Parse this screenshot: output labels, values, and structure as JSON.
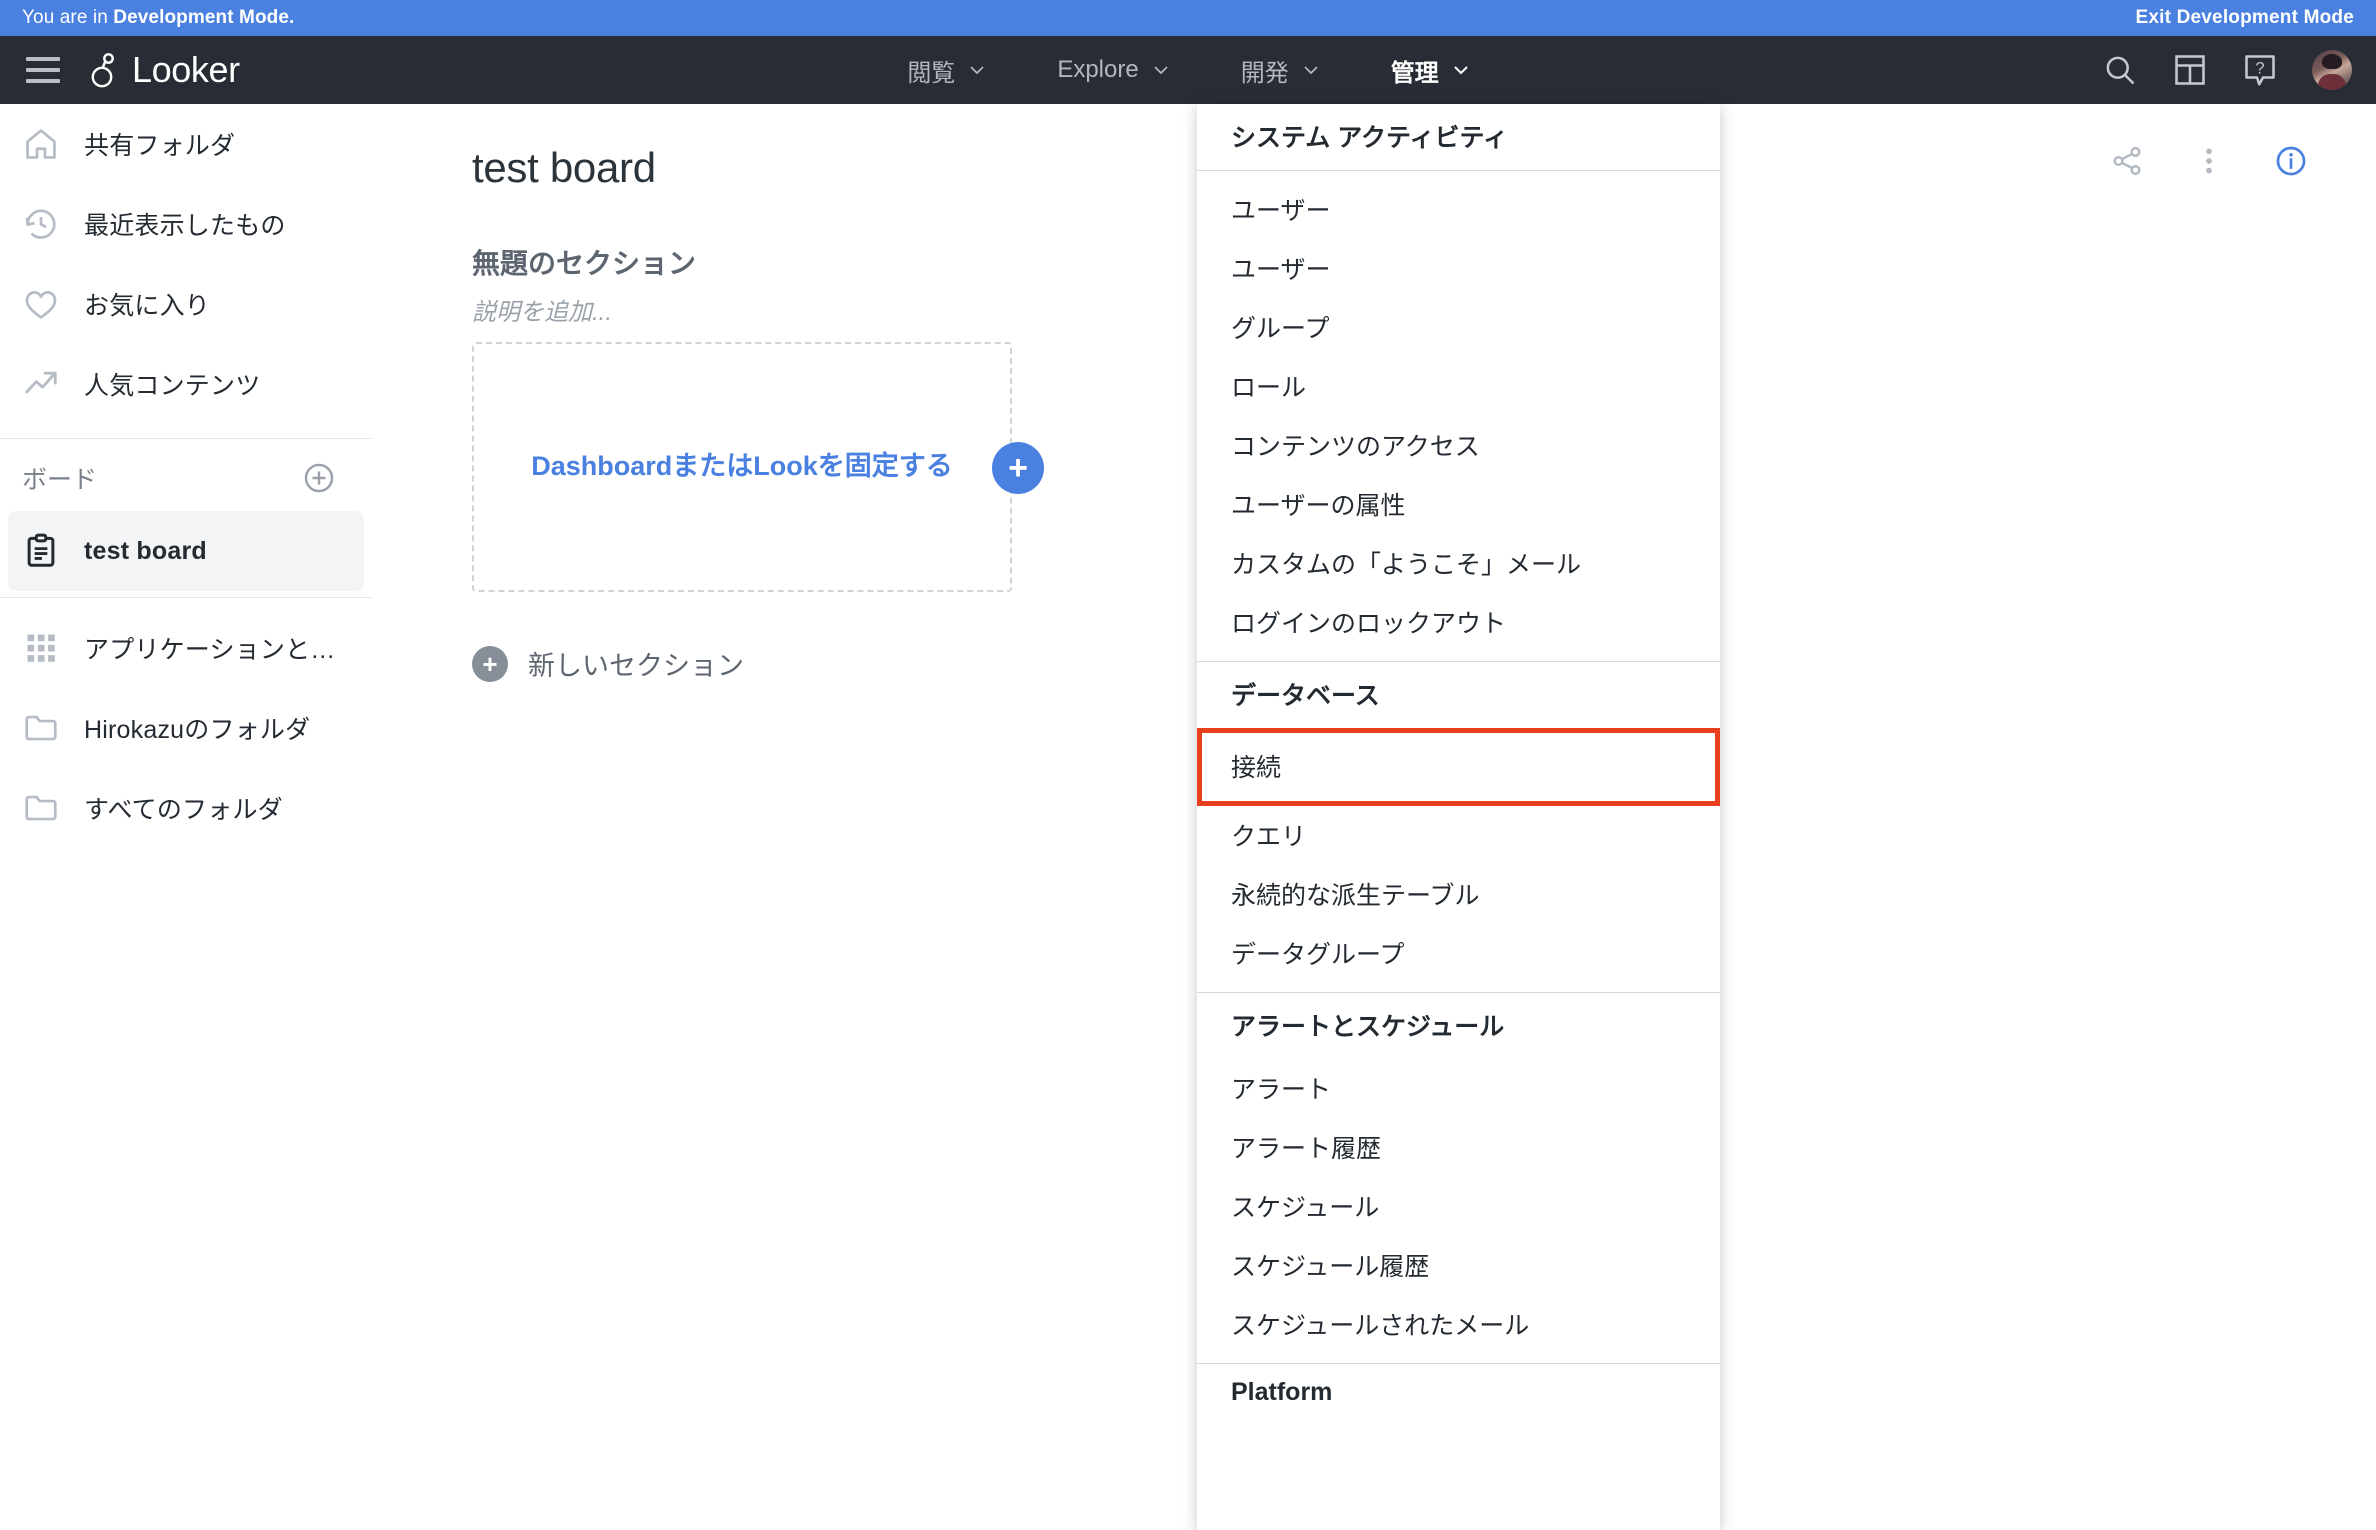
{
  "dev_banner": {
    "message_prefix": "You are in ",
    "message_bold": "Development Mode.",
    "exit_label": "Exit Development Mode",
    "background_color": "#4a80e0"
  },
  "topbar": {
    "hamburger_name": "menu-icon",
    "brand": "Looker",
    "nav": [
      {
        "label": "閲覧",
        "active": false
      },
      {
        "label": "Explore",
        "active": false
      },
      {
        "label": "開発",
        "active": false
      },
      {
        "label": "管理",
        "active": true
      }
    ],
    "icons": [
      "search-icon",
      "marketplace-icon",
      "help-icon",
      "avatar"
    ],
    "background_color": "#282c34"
  },
  "sidebar": {
    "primary_items": [
      {
        "icon": "home-icon",
        "label": "共有フォルダ"
      },
      {
        "icon": "history-icon",
        "label": "最近表示したもの"
      },
      {
        "icon": "heart-icon",
        "label": "お気に入り"
      },
      {
        "icon": "trending-up-icon",
        "label": "人気コンテンツ"
      }
    ],
    "boards_header": {
      "label": "ボード",
      "add_icon": "plus-circle-icon"
    },
    "boards": [
      {
        "icon": "clipboard-icon",
        "label": "test board",
        "selected": true
      }
    ],
    "secondary_items": [
      {
        "icon": "grid-apps-icon",
        "label": "アプリケーションと…"
      },
      {
        "icon": "folder-icon",
        "label": "Hirokazuのフォルダ"
      },
      {
        "icon": "folder-icon",
        "label": "すべてのフォルダ"
      }
    ]
  },
  "main": {
    "board_title": "test board",
    "actions": [
      "share-icon",
      "more-vertical-icon",
      "info-icon"
    ],
    "section_title": "無題のセクション",
    "section_description_placeholder": "説明を追加...",
    "pin_cta": "DashboardまたはLookを固定する",
    "pin_fab_label": "+",
    "new_section_label": "新しいセクション",
    "new_section_icon_label": "+",
    "accent_color": "#4a80e0"
  },
  "admin_menu": {
    "highlight_color": "#e8401f",
    "groups": [
      {
        "header": "システム アクティビティ",
        "items": []
      },
      {
        "header": null,
        "items": [
          {
            "label": "ユーザー",
            "highlighted": false
          },
          {
            "label": "ユーザー",
            "highlighted": false
          },
          {
            "label": "グループ",
            "highlighted": false
          },
          {
            "label": "ロール",
            "highlighted": false
          },
          {
            "label": "コンテンツのアクセス",
            "highlighted": false
          },
          {
            "label": "ユーザーの属性",
            "highlighted": false
          },
          {
            "label": "カスタムの「ようこそ」メール",
            "highlighted": false
          },
          {
            "label": "ログインのロックアウト",
            "highlighted": false
          }
        ]
      },
      {
        "header": "データベース",
        "items": [
          {
            "label": "接続",
            "highlighted": true
          },
          {
            "label": "クエリ",
            "highlighted": false
          },
          {
            "label": "永続的な派生テーブル",
            "highlighted": false
          },
          {
            "label": "データグループ",
            "highlighted": false
          }
        ]
      },
      {
        "header": "アラートとスケジュール",
        "items": [
          {
            "label": "アラート",
            "highlighted": false
          },
          {
            "label": "アラート履歴",
            "highlighted": false
          },
          {
            "label": "スケジュール",
            "highlighted": false
          },
          {
            "label": "スケジュール履歴",
            "highlighted": false
          },
          {
            "label": "スケジュールされたメール",
            "highlighted": false
          }
        ]
      },
      {
        "header": "Platform",
        "items": []
      }
    ]
  }
}
